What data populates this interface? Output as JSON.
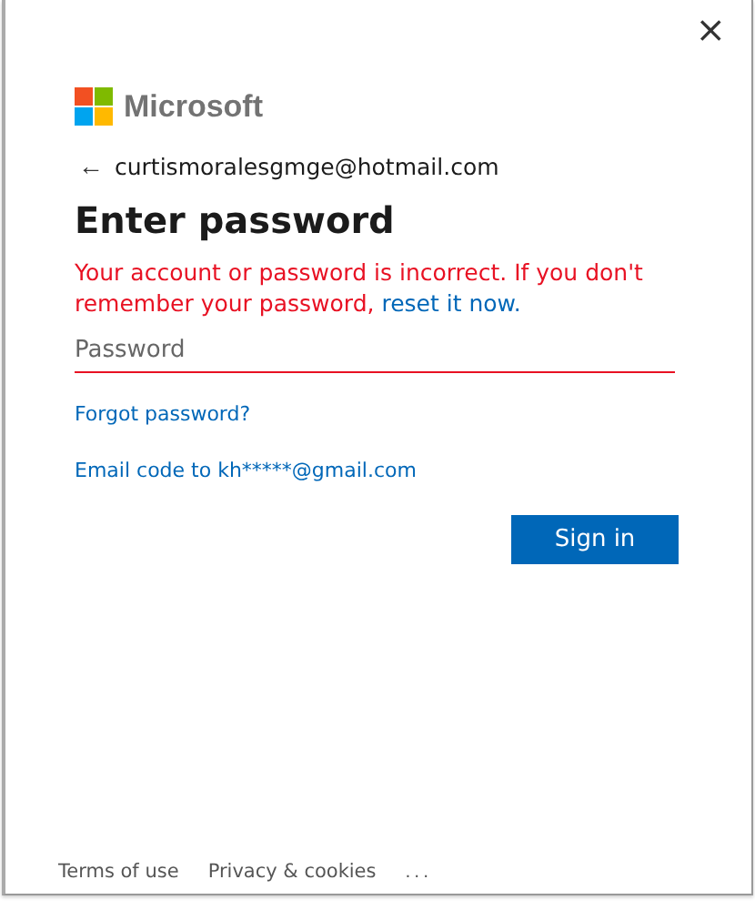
{
  "close_label": "×",
  "brand": {
    "name": "Microsoft"
  },
  "back": {
    "label": "←",
    "email": "curtismoralesgmge@hotmail.com"
  },
  "heading": "Enter password",
  "error": {
    "text": "Your account or password is incorrect. If you don't remember your password,",
    "link": "reset it now."
  },
  "password_field": {
    "placeholder": "Password",
    "invalid": true
  },
  "links": [
    "Forgot password?",
    "Email code to kh*****@gmail.com"
  ],
  "sign_in_button": "Sign in",
  "footer": {
    "links": [
      "Terms of use",
      "Privacy & cookies"
    ],
    "more": "..."
  }
}
